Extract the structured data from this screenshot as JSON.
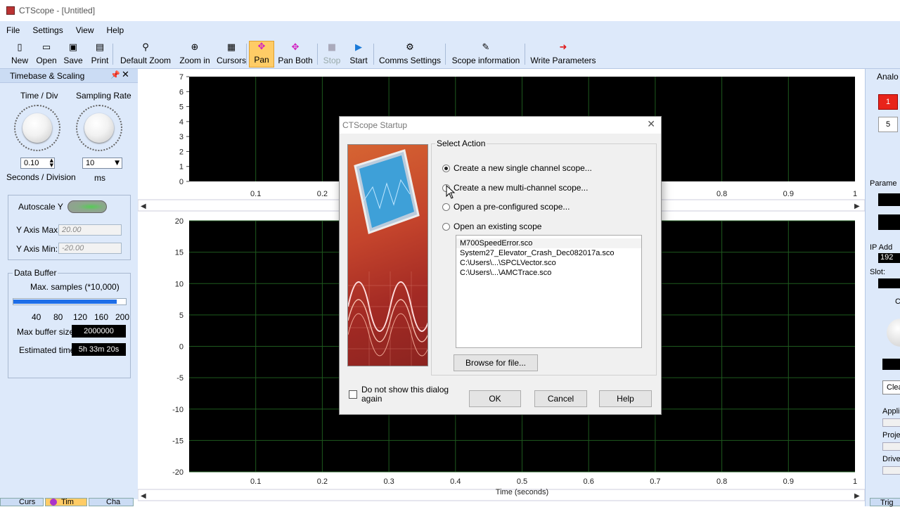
{
  "window": {
    "title": "CTScope - [Untitled]"
  },
  "menu": [
    "File",
    "Settings",
    "View",
    "Help"
  ],
  "toolbar": [
    {
      "label": "New",
      "icon": "new-file-icon",
      "glyph": "▯"
    },
    {
      "label": "Open",
      "icon": "open-folder-icon",
      "glyph": "▭"
    },
    {
      "label": "Save",
      "icon": "save-icon",
      "glyph": "▣"
    },
    {
      "label": "Print",
      "icon": "print-icon",
      "glyph": "▤"
    },
    {
      "label": "Default Zoom",
      "icon": "zoom-icon",
      "glyph": "⚲"
    },
    {
      "label": "Zoom in",
      "icon": "zoom-in-icon",
      "glyph": "⊕"
    },
    {
      "label": "Cursors",
      "icon": "cursors-icon",
      "glyph": "▦"
    },
    {
      "label": "Pan",
      "icon": "pan-icon",
      "glyph": "✥"
    },
    {
      "label": "Pan Both",
      "icon": "pan-both-icon",
      "glyph": "✥"
    },
    {
      "label": "Stop",
      "icon": "stop-icon",
      "glyph": "■"
    },
    {
      "label": "Start",
      "icon": "start-icon",
      "glyph": "▶"
    },
    {
      "label": "Comms Settings",
      "icon": "comms-settings-icon",
      "glyph": "⚙"
    },
    {
      "label": "Scope information",
      "icon": "scope-information-icon",
      "glyph": "✎"
    },
    {
      "label": "Write Parameters",
      "icon": "write-parameters-icon",
      "glyph": "➜"
    }
  ],
  "left_panel": {
    "title": "Timebase & Scaling",
    "time_div_label": "Time / Div",
    "sampling_rate_label": "Sampling Rate",
    "time_div_value": "0.10",
    "sampling_rate_value": "10",
    "seconds_label": "Seconds / Division",
    "ms_label": "ms",
    "autoscale_label": "Autoscale Y",
    "ymax_label": "Y Axis Max:",
    "ymax_value": "20.00",
    "ymin_label": "Y Axis Min:",
    "ymin_value": "-20.00",
    "buffer_group": "Data Buffer",
    "max_samples_label": "Max. samples (*10,000)",
    "slider_ticks": [
      "40",
      "80",
      "120",
      "160",
      "200"
    ],
    "slider_fraction": 0.92,
    "max_buffer_label": "Max buffer size:",
    "max_buffer_value": "2000000",
    "est_time_label": "Estimated time:",
    "est_time_value": "5h 33m 20s"
  },
  "bottom_tabs": [
    "Curs",
    "Tim",
    "Cha"
  ],
  "top_plot": {
    "y_ticks": [
      "7",
      "6",
      "5",
      "4",
      "3",
      "2",
      "1",
      "0"
    ],
    "x_ticks": [
      "0.1",
      "0.2",
      "0.8",
      "0.9",
      "1"
    ]
  },
  "bottom_plot": {
    "y_ticks": [
      "20",
      "15",
      "10",
      "5",
      "0",
      "-5",
      "-10",
      "-15",
      "-20"
    ],
    "x_ticks": [
      "0.1",
      "0.2",
      "0.3",
      "0.4",
      "0.5",
      "0.6",
      "0.7",
      "0.8",
      "0.9",
      "1"
    ],
    "xlabel": "Time (seconds)"
  },
  "right_panel": {
    "header": "Analo",
    "ch1": "1",
    "ch5": "5",
    "param": "Parame",
    "ip": "IP Add",
    "ip_value": "192",
    "slot": "Slot:",
    "c": "C",
    "clear": "Clea",
    "appl": "Applic",
    "proj": "Proje",
    "drive": "Drive",
    "trig": "Trig"
  },
  "dialog": {
    "title": "CTScope Startup",
    "group_label": "Select Action",
    "options": [
      "Create a new single channel scope...",
      "Create a new multi-channel scope...",
      "Open a pre-configured scope...",
      "Open an existing scope"
    ],
    "selected_option": 0,
    "files": [
      "M700SpeedError.sco",
      "System27_Elevator_Crash_Dec082017a.sco",
      "C:\\Users\\...\\SPCLVector.sco",
      "C:\\Users\\...\\AMCTrace.sco"
    ],
    "browse_label": "Browse for file...",
    "dont_show_label": "Do not show this dialog again",
    "ok_label": "OK",
    "cancel_label": "Cancel",
    "help_label": "Help"
  }
}
